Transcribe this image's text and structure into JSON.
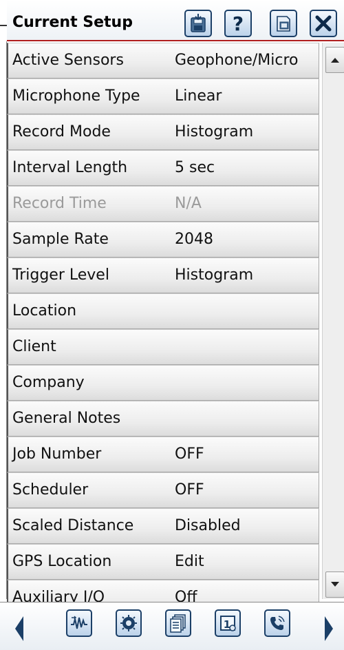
{
  "header": {
    "title": "Current Setup",
    "buttons": [
      "save-icon",
      "help-icon",
      "screen-icon",
      "close-icon"
    ]
  },
  "rows": [
    {
      "label": "Active Sensors",
      "value": "Geophone/Micro",
      "enabled": true
    },
    {
      "label": "Microphone Type",
      "value": "Linear",
      "enabled": true
    },
    {
      "label": "Record Mode",
      "value": "Histogram",
      "enabled": true
    },
    {
      "label": "Interval Length",
      "value": "5 sec",
      "enabled": true
    },
    {
      "label": "Record Time",
      "value": "N/A",
      "enabled": false
    },
    {
      "label": "Sample Rate",
      "value": "2048",
      "enabled": true
    },
    {
      "label": "Trigger Level",
      "value": "Histogram",
      "enabled": true
    },
    {
      "label": "Location",
      "value": "",
      "enabled": true
    },
    {
      "label": "Client",
      "value": "",
      "enabled": true
    },
    {
      "label": "Company",
      "value": "",
      "enabled": true
    },
    {
      "label": "General Notes",
      "value": "",
      "enabled": true
    },
    {
      "label": "Job Number",
      "value": "OFF",
      "enabled": true
    },
    {
      "label": "Scheduler",
      "value": "OFF",
      "enabled": true
    },
    {
      "label": "Scaled Distance",
      "value": "Disabled",
      "enabled": true
    },
    {
      "label": "GPS Location",
      "value": "Edit",
      "enabled": true
    },
    {
      "label": "Auxiliary I/O",
      "value": "Off",
      "enabled": true
    }
  ],
  "toolbar": {
    "icons": [
      "waveform-icon",
      "sensor-icon",
      "documents-icon",
      "calendar-icon",
      "phone-icon"
    ]
  },
  "colors": {
    "accent_red": "#b01e1e",
    "button_border": "#1b3f67",
    "disabled_text": "#9a9a9a"
  }
}
